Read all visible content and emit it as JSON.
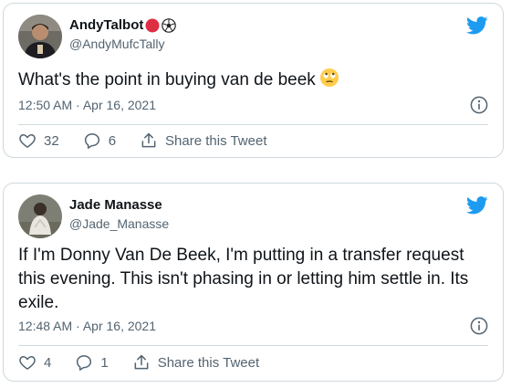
{
  "tweets": [
    {
      "display_name": "AndyTalbot",
      "name_emojis": [
        "red-circle",
        "soccer-ball"
      ],
      "handle": "@AndyMufcTally",
      "text": "What's the point in buying van de beek",
      "text_emoji": "face-with-rolling-eyes",
      "timestamp": "12:50 AM · Apr 16, 2021",
      "likes": "32",
      "replies": "6",
      "share_label": "Share this Tweet"
    },
    {
      "display_name": "Jade Manasse",
      "name_emojis": [],
      "handle": "@Jade_Manasse",
      "text": "If I'm Donny Van De Beek, I'm putting in a transfer request this evening. This isn't phasing in or letting him settle in. Its exile.",
      "timestamp": "12:48 AM · Apr 16, 2021",
      "likes": "4",
      "replies": "1",
      "share_label": "Share this Tweet"
    }
  ],
  "colors": {
    "twitter_blue": "#1d9bf0",
    "secondary_text": "#536471",
    "border": "#cfd9de"
  },
  "icons": {
    "logo": "twitter-bird-icon",
    "info": "info-icon",
    "like": "heart-icon",
    "reply": "reply-icon",
    "share": "share-icon"
  }
}
